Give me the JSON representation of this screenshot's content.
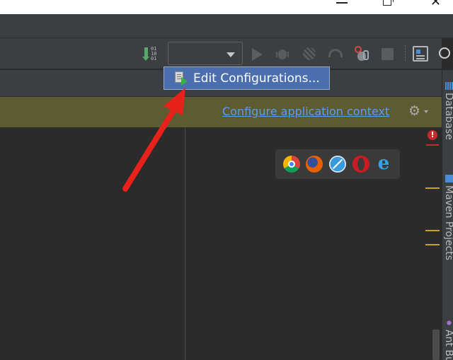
{
  "popup": {
    "edit_configurations_label": "Edit Configurations...",
    "icon": "edit-configurations-icon"
  },
  "banner": {
    "configure_link": "Configure application context",
    "gear_icon": "gear-icon"
  },
  "toolbar": {
    "binary_bits": [
      "01",
      "10",
      "01"
    ],
    "run_config_value": "",
    "icons": [
      "binary-update-icon",
      "run-icon",
      "debug-icon",
      "coverage-icon",
      "profile-icon",
      "attach-debugger-icon",
      "stop-icon",
      "project-structure-icon",
      "search-icon"
    ]
  },
  "browsers": [
    "chrome-icon",
    "firefox-icon",
    "safari-icon",
    "opera-icon",
    "internet-explorer-icon"
  ],
  "right_panel": {
    "tabs": [
      "Database",
      "Maven Projects",
      "Ant Bu"
    ]
  },
  "editor": {
    "error_glyph": "!"
  },
  "colors": {
    "toolbar_bg": "#3c3f41",
    "editor_bg": "#2b2b2b",
    "banner_bg": "#5d5b32",
    "link": "#589df6",
    "popup_bg": "#4b6eaf",
    "annotation_arrow": "#e8221a",
    "warning_mark": "#c8a21a",
    "error": "#c42b2b"
  }
}
